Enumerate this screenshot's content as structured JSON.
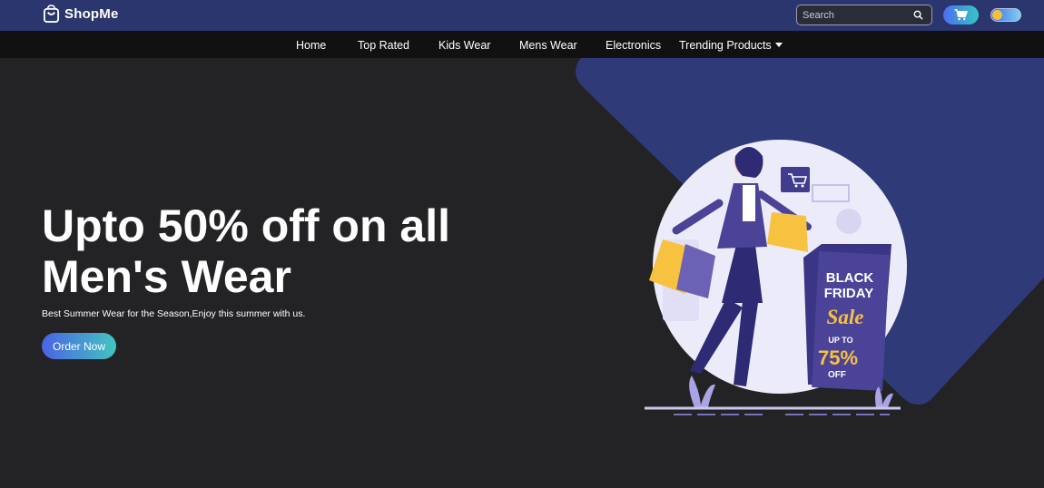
{
  "header": {
    "brand_name": "ShopMe",
    "brand_icon": "shopping-bag-icon",
    "search": {
      "placeholder": "Search",
      "value": ""
    },
    "cart_icon": "cart-icon",
    "theme_toggle": "dark-mode-toggle"
  },
  "nav": {
    "items": [
      {
        "label": "Home"
      },
      {
        "label": "Top Rated"
      },
      {
        "label": "Kids Wear"
      },
      {
        "label": "Mens Wear"
      },
      {
        "label": "Electronics"
      },
      {
        "label": "Trending Products",
        "has_dropdown": true
      }
    ]
  },
  "hero": {
    "headline": "Upto 50% off on all Men's Wear",
    "subline": "Best Summer Wear for the Season,Enjoy this summer with us.",
    "cta_label": "Order Now",
    "sign": {
      "line1": "BLACK",
      "line2": "FRIDAY",
      "line3": "Sale",
      "line4": "UP TO",
      "line5": "75%",
      "line6": "OFF"
    }
  },
  "colors": {
    "topbar": "#2b356e",
    "navbar": "#111112",
    "background": "#232325",
    "accent_shape": "#2f3a78",
    "button_gradient_start": "#4a63e6",
    "button_gradient_end": "#44c4bf"
  }
}
